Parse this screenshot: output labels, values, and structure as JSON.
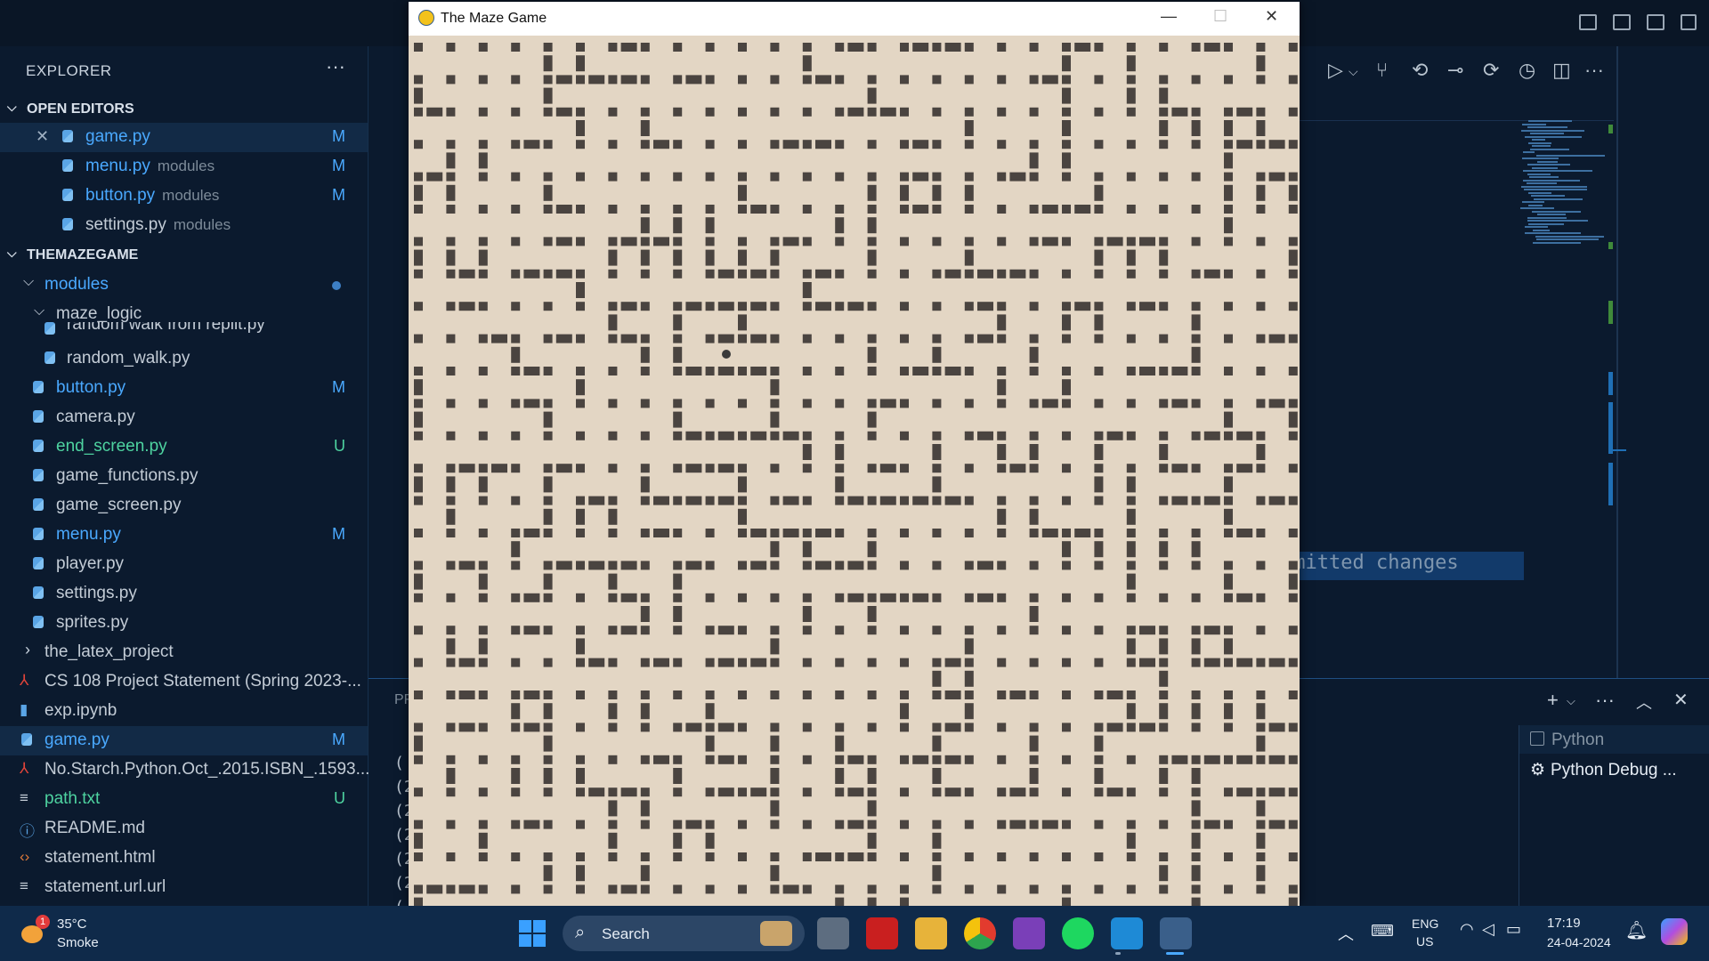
{
  "vscode": {
    "explorer_title": "EXPLORER",
    "explorer_more": "···",
    "open_editors_label": "OPEN EDITORS",
    "project_label": "THEMAZEGAME",
    "open_editors": [
      {
        "name": "game.py",
        "sub": "",
        "status": "M",
        "close": "✕"
      },
      {
        "name": "menu.py",
        "sub": "modules",
        "status": "M"
      },
      {
        "name": "button.py",
        "sub": "modules",
        "status": "M"
      },
      {
        "name": "settings.py",
        "sub": "modules",
        "status": ""
      }
    ],
    "tree": {
      "modules_folder": "modules",
      "maze_logic_folder": "maze_logic",
      "partial_file": "random walk from replit.py",
      "random_walk": "random_walk.py",
      "module_files": [
        {
          "name": "button.py",
          "status": "M"
        },
        {
          "name": "camera.py",
          "status": ""
        },
        {
          "name": "end_screen.py",
          "status": "U"
        },
        {
          "name": "game_functions.py",
          "status": ""
        },
        {
          "name": "game_screen.py",
          "status": ""
        },
        {
          "name": "menu.py",
          "status": "M"
        },
        {
          "name": "player.py",
          "status": ""
        },
        {
          "name": "settings.py",
          "status": ""
        },
        {
          "name": "sprites.py",
          "status": ""
        }
      ],
      "latex_folder": "the_latex_project",
      "root_files": [
        {
          "name": "CS 108 Project Statement (Spring 2023-...",
          "status": ""
        },
        {
          "name": "exp.ipynb",
          "status": ""
        },
        {
          "name": "game.py",
          "status": "M"
        },
        {
          "name": "No.Starch.Python.Oct_.2015.ISBN_.1593...",
          "status": ""
        },
        {
          "name": "path.txt",
          "status": "U"
        },
        {
          "name": "README.md",
          "status": ""
        },
        {
          "name": "statement.html",
          "status": ""
        },
        {
          "name": "statement.url.url",
          "status": ""
        }
      ]
    },
    "uncommitted_text": "mmitted changes",
    "panel_tab_fragment": "PF",
    "terminal_lines": [
      "(",
      "(2",
      "(2",
      "(2",
      "(2",
      "(2",
      "("
    ],
    "terminals": [
      {
        "name": "Python"
      },
      {
        "name": "Python Debug ..."
      }
    ]
  },
  "game_window": {
    "title": "The Maze Game",
    "minimize": "—",
    "maximize": "☐",
    "close": "✕"
  },
  "taskbar": {
    "weather_temp": "35°C",
    "weather_desc": "Smoke",
    "weather_badge": "1",
    "search_label": "Search",
    "language": "ENG",
    "region": "US",
    "time": "17:19",
    "date": "24-04-2024"
  },
  "colors": {
    "accent": "#4aa9ff",
    "modified": "#4aa9ff",
    "untracked": "#4ed3a0",
    "maze_floor": "#e3d6c4",
    "maze_wall": "#4a4440"
  }
}
